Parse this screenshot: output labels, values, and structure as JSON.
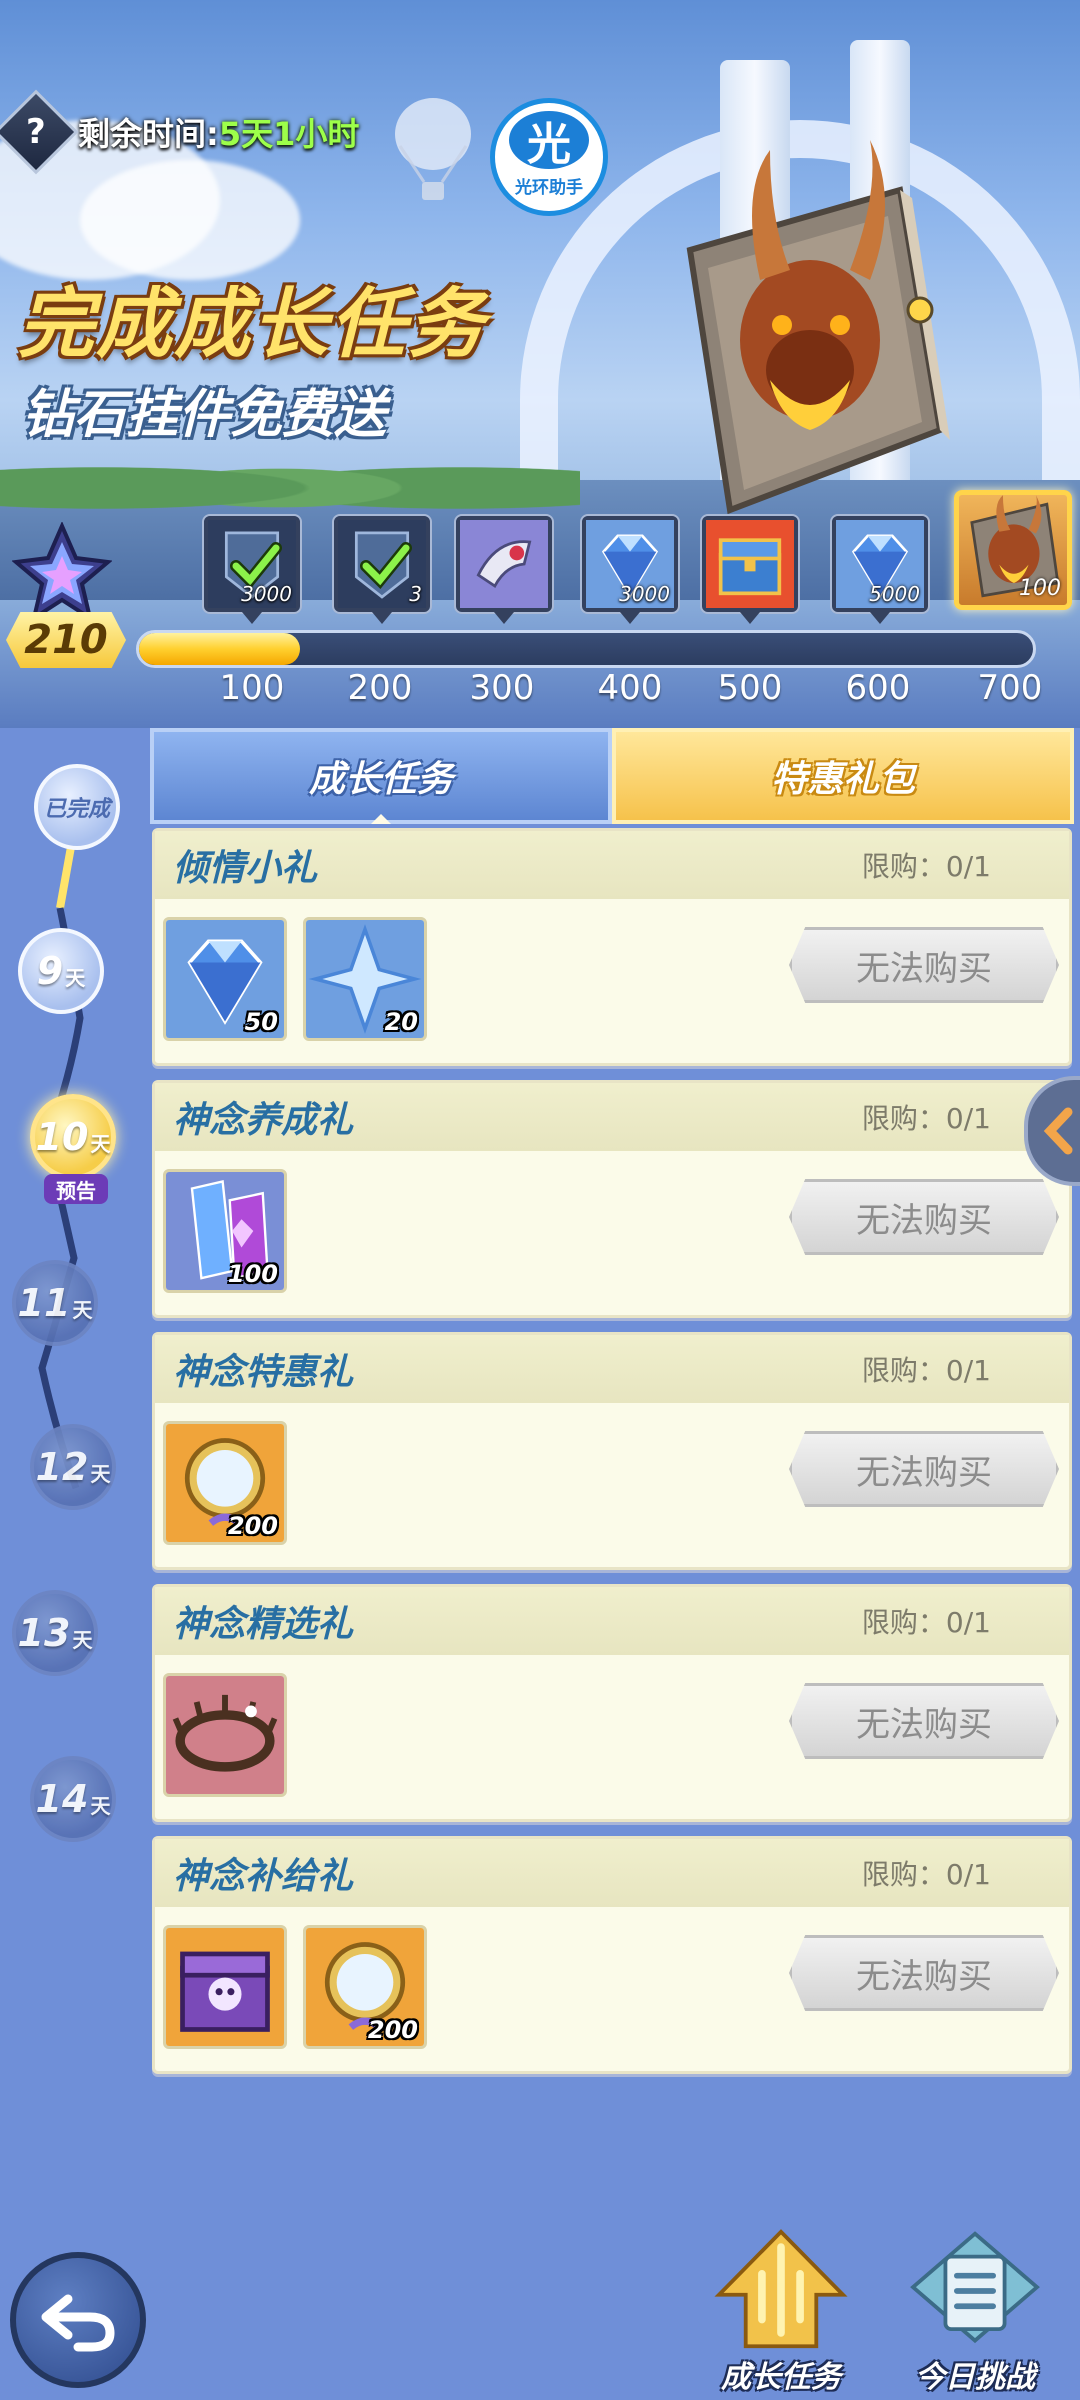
{
  "header": {
    "timer_label": "剩余时间:",
    "timer_value": "5天1小时",
    "help_glyph": "?",
    "helper_badge": {
      "glyph": "光",
      "label": "光环助手"
    },
    "promo_title": "完成成长任务",
    "promo_subtitle": "钻石挂件免费送"
  },
  "progress": {
    "score": "210",
    "fill_fraction": 0.18,
    "ticks": [
      "100",
      "200",
      "300",
      "400",
      "500",
      "600",
      "700"
    ],
    "rewards": [
      {
        "icon": "badge-icon",
        "amount": "3000",
        "claimed": true
      },
      {
        "icon": "badge-icon",
        "amount": "3",
        "claimed": true
      },
      {
        "icon": "gauntlet-icon",
        "amount": "",
        "claimed": false
      },
      {
        "icon": "diamond-icon",
        "amount": "3000",
        "claimed": false
      },
      {
        "icon": "treasure-chest-icon",
        "amount": "",
        "claimed": false
      },
      {
        "icon": "diamond-icon",
        "amount": "5000",
        "claimed": false
      }
    ],
    "final_reward": {
      "icon": "dragon-book-icon",
      "amount": "100"
    }
  },
  "days": [
    {
      "label": "已完成",
      "state": "completed"
    },
    {
      "num": "9",
      "unit": "天",
      "state": "completed"
    },
    {
      "num": "10",
      "unit": "天",
      "state": "active"
    },
    {
      "num": "11",
      "unit": "天",
      "state": "locked"
    },
    {
      "num": "12",
      "unit": "天",
      "state": "locked"
    },
    {
      "num": "13",
      "unit": "天",
      "state": "locked"
    },
    {
      "num": "14",
      "unit": "天",
      "state": "locked"
    }
  ],
  "preview_tag": "预告",
  "tabs": [
    {
      "label": "成长任务",
      "active": true
    },
    {
      "label": "特惠礼包",
      "active": false
    }
  ],
  "gifts": [
    {
      "title": "倾情小礼",
      "limit": "限购：0/1",
      "button": "无法购买",
      "items": [
        {
          "icon": "diamond-icon",
          "amount": "50"
        },
        {
          "icon": "crystal-shard-icon",
          "amount": "20"
        }
      ]
    },
    {
      "title": "神念养成礼",
      "limit": "限购：0/1",
      "button": "无法购买",
      "items": [
        {
          "icon": "crystal-card-icon",
          "amount": "100"
        }
      ]
    },
    {
      "title": "神念特惠礼",
      "limit": "限购：0/1",
      "button": "无法购买",
      "items": [
        {
          "icon": "mirror-icon",
          "amount": "200"
        }
      ]
    },
    {
      "title": "神念精选礼",
      "limit": "限购：0/1",
      "button": "无法购买",
      "items": [
        {
          "icon": "thorn-crown-icon",
          "amount": ""
        }
      ]
    },
    {
      "title": "神念补给礼",
      "limit": "限购：0/1",
      "button": "无法购买",
      "items": [
        {
          "icon": "skull-chest-icon",
          "amount": ""
        },
        {
          "icon": "mirror-icon",
          "amount": "200"
        }
      ]
    }
  ],
  "bottom_nav": [
    {
      "label": "成长任务",
      "icon": "trident-icon"
    },
    {
      "label": "今日挑战",
      "icon": "scroll-icon"
    }
  ],
  "colors": {
    "accent_gold": "#ffd02e",
    "title_blue": "#286fa3",
    "timer_green": "#9dff4a"
  }
}
